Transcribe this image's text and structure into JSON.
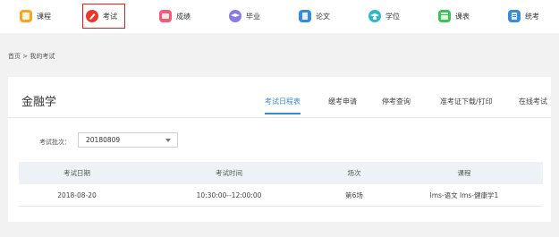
{
  "nav": {
    "items": [
      {
        "label": "课程",
        "icon": "course-icon",
        "color": "#f5a623"
      },
      {
        "label": "考试",
        "icon": "exam-icon",
        "color": "#e8382c"
      },
      {
        "label": "成绩",
        "icon": "grade-icon",
        "color": "#f25c7a"
      },
      {
        "label": "毕业",
        "icon": "graduation-icon",
        "color": "#8a7be0"
      },
      {
        "label": "论文",
        "icon": "thesis-icon",
        "color": "#3a8bd6"
      },
      {
        "label": "学位",
        "icon": "degree-icon",
        "color": "#2fb7c8"
      },
      {
        "label": "课表",
        "icon": "schedule-icon",
        "color": "#3cc25a"
      },
      {
        "label": "统考",
        "icon": "unified-exam-icon",
        "color": "#3a8bd6"
      }
    ]
  },
  "breadcrumb": {
    "text": "首页 > 我的考试"
  },
  "card": {
    "title": "金融学",
    "tabs": [
      {
        "label": "考试日程表"
      },
      {
        "label": "缓考申请"
      },
      {
        "label": "停考查询"
      },
      {
        "label": "准考证下载/打印"
      },
      {
        "label": "在线考试"
      }
    ],
    "filter": {
      "label": "考试批次：",
      "value": "20180809"
    },
    "table": {
      "headers": [
        "考试日期",
        "考试时间",
        "场次",
        "课程"
      ],
      "rows": [
        [
          "2018-08-20",
          "10:30:00--12:00:00",
          "第6场",
          "lms-语文 lms-健康学1"
        ]
      ]
    }
  },
  "colors": {
    "accent": "#3a8bd6",
    "active_border": "#e02020"
  }
}
